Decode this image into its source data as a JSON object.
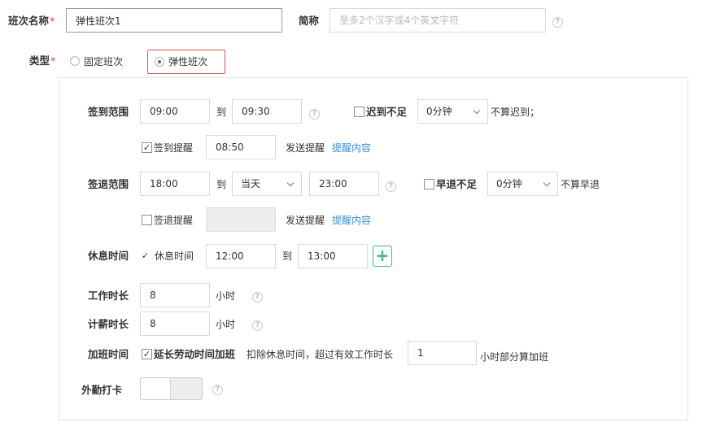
{
  "name_row": {
    "label": "班次名称",
    "required_mark": "*",
    "name_value": "弹性班次1",
    "short_label": "简称",
    "short_placeholder": "至多2个汉字或4个英文字符",
    "help_glyph": "?"
  },
  "type_row": {
    "label": "类型",
    "required_mark": "*",
    "option_fixed": "固定班次",
    "option_flexible": "弹性班次",
    "selected": "弹性班次"
  },
  "checkin_range": {
    "label": "签到范围",
    "start": "09:00",
    "to": "到",
    "end": "09:30",
    "late_checked": false,
    "late_label": "迟到不足",
    "late_select": "0分钟",
    "late_suffix": "不算迟到；"
  },
  "checkin_reminder": {
    "checked": true,
    "check_mark": "✓",
    "label": "签到提醒",
    "time": "08:50",
    "send_text": "发送提醒",
    "link": "提醒内容"
  },
  "checkout_range": {
    "label": "签退范围",
    "start": "18:00",
    "to": "到",
    "day_select": "当天",
    "end": "23:00",
    "early_checked": false,
    "early_label": "早退不足",
    "early_select": "0分钟",
    "early_suffix": "不算早退"
  },
  "checkout_reminder": {
    "checked": false,
    "label": "签退提醒",
    "time": "",
    "send_text": "发送提醒",
    "link": "提醒内容"
  },
  "rest_time": {
    "label": "休息时间",
    "checked": true,
    "check_mark": "✓",
    "check_label": "休息时间",
    "start": "12:00",
    "to": "到",
    "end": "13:00",
    "add_glyph": "+"
  },
  "work_hours": {
    "label": "工作时长",
    "value": "8",
    "unit": "小时"
  },
  "paid_hours": {
    "label": "计薪时长",
    "value": "8",
    "unit": "小时"
  },
  "overtime": {
    "label": "加班时间",
    "checked": true,
    "check_mark": "✓",
    "check_label": "延长劳动时间加班",
    "desc": "扣除休息时间，超过有效工作时长",
    "value": "1",
    "suffix": "小时部分算加班"
  },
  "field_punch": {
    "label": "外勤打卡",
    "enabled": false
  },
  "colors": {
    "accent_green": "#3bb58d",
    "link_blue": "#3b8ed8",
    "required_red": "#e4393c",
    "radio_border_red": "#d9534f"
  }
}
